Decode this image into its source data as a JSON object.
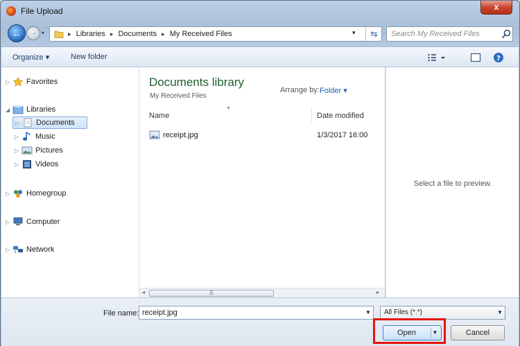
{
  "window": {
    "title": "File Upload",
    "close_label": "x"
  },
  "address": {
    "crumbs": [
      "Libraries",
      "Documents",
      "My Received Files"
    ],
    "separator": "▸",
    "search_placeholder": "Search My Received Files"
  },
  "toolbar": {
    "organize": "Organize ▾",
    "new_folder": "New folder"
  },
  "nav": {
    "favorites": "Favorites",
    "libraries": "Libraries",
    "documents": "Documents",
    "music": "Music",
    "pictures": "Pictures",
    "videos": "Videos",
    "homegroup": "Homegroup",
    "computer": "Computer",
    "network": "Network"
  },
  "library": {
    "title": "Documents library",
    "subtitle": "My Received Files",
    "arrange_label": "Arrange by:",
    "arrange_value": "Folder ▾"
  },
  "columns": {
    "name": "Name",
    "date": "Date modified"
  },
  "files": [
    {
      "name": "receipt.jpg",
      "date": "1/3/2017 16:00"
    }
  ],
  "preview": {
    "text": "Select a file to preview."
  },
  "bottom": {
    "file_name_label": "File name:",
    "file_name_value": "receipt.jpg",
    "filter_value": "All Files (*.*)",
    "open_label": "Open",
    "cancel_label": "Cancel"
  },
  "colors": {
    "highlight": "#e8140c",
    "library_title": "#1e5f2f",
    "link": "#1f5fb5"
  },
  "icons": [
    "app-icon",
    "back-arrow-icon",
    "forward-arrow-icon",
    "folder-icon",
    "refresh-icon",
    "search-icon",
    "view-options-icon",
    "preview-pane-icon",
    "help-icon",
    "star-icon",
    "library-icon",
    "document-icon",
    "music-icon",
    "pictures-icon",
    "videos-icon",
    "homegroup-icon",
    "computer-icon",
    "network-icon",
    "image-file-icon"
  ]
}
